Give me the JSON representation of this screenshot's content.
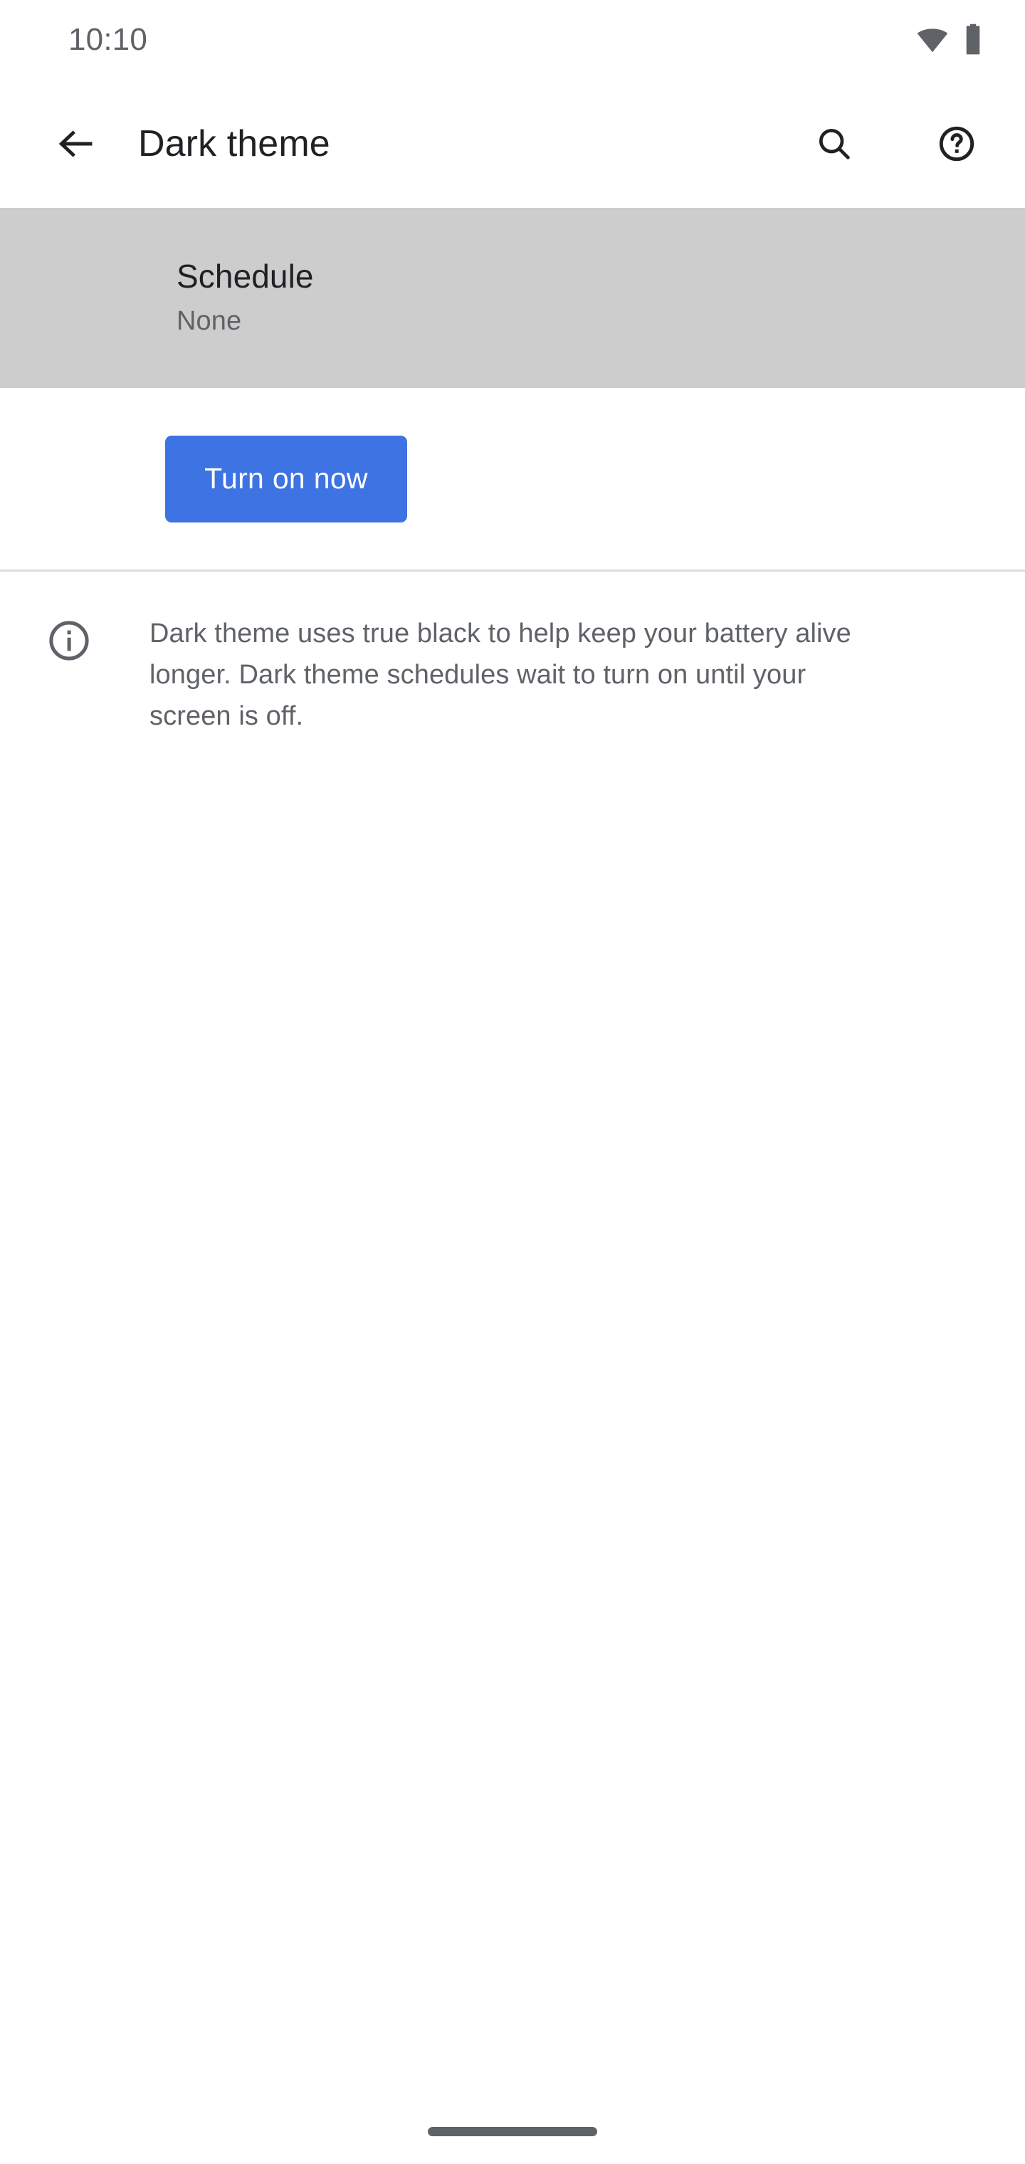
{
  "status_bar": {
    "time": "10:10",
    "icons": [
      {
        "name": "wifi-icon",
        "label": "Wi-Fi connected"
      },
      {
        "name": "battery-icon",
        "label": "Battery full"
      }
    ]
  },
  "app_bar": {
    "back_label": "Navigate up",
    "title": "Dark theme",
    "actions": [
      {
        "name": "search-icon",
        "label": "Search"
      },
      {
        "name": "help-icon",
        "label": "Help & feedback"
      }
    ]
  },
  "schedule": {
    "title": "Schedule",
    "value": "None",
    "highlight_color": "#cdcdcd"
  },
  "primary_action": {
    "label": "Turn on now",
    "color": "#3d73e3",
    "text_color": "#ffffff"
  },
  "info": {
    "icon": "info-icon",
    "text": "Dark theme uses true black to help keep your battery alive longer. Dark theme schedules wait to turn on until your screen is off."
  },
  "nav_bar": {
    "gesture_label": "Home gesture handle"
  },
  "colors": {
    "background": "#ffffff",
    "primary_text": "#202124",
    "secondary_text": "#5f6368",
    "divider": "#dadce0",
    "accent": "#3d73e3",
    "highlight": "#cdcdcd"
  }
}
